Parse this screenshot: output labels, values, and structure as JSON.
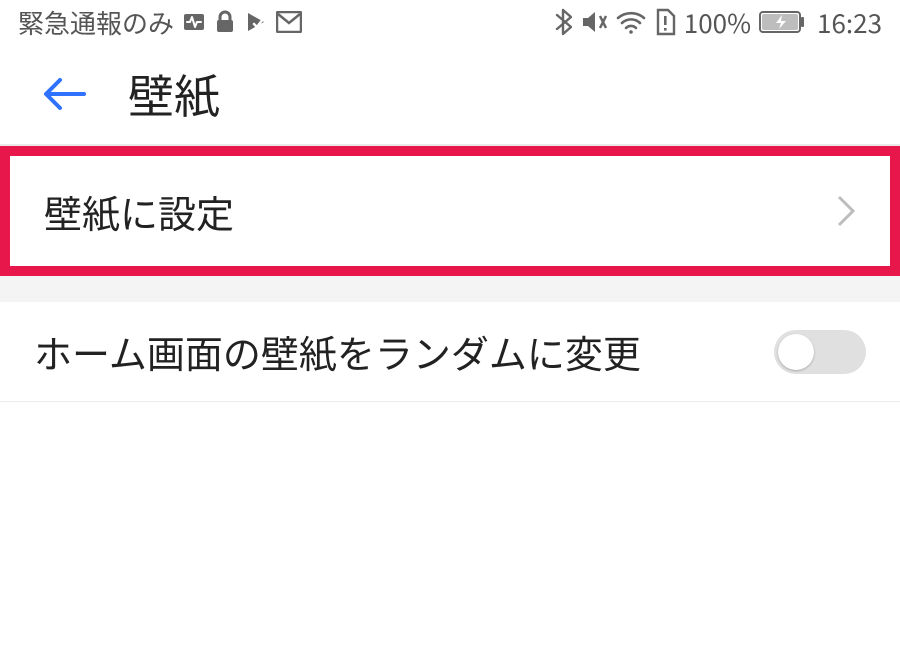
{
  "status": {
    "carrier": "緊急通報のみ",
    "battery_pct": "100%",
    "time": "16:23"
  },
  "header": {
    "title": "壁紙"
  },
  "rows": {
    "set_wallpaper": "壁紙に設定",
    "random_home": "ホーム画面の壁紙をランダムに変更"
  },
  "toggles": {
    "random_home_on": false
  }
}
